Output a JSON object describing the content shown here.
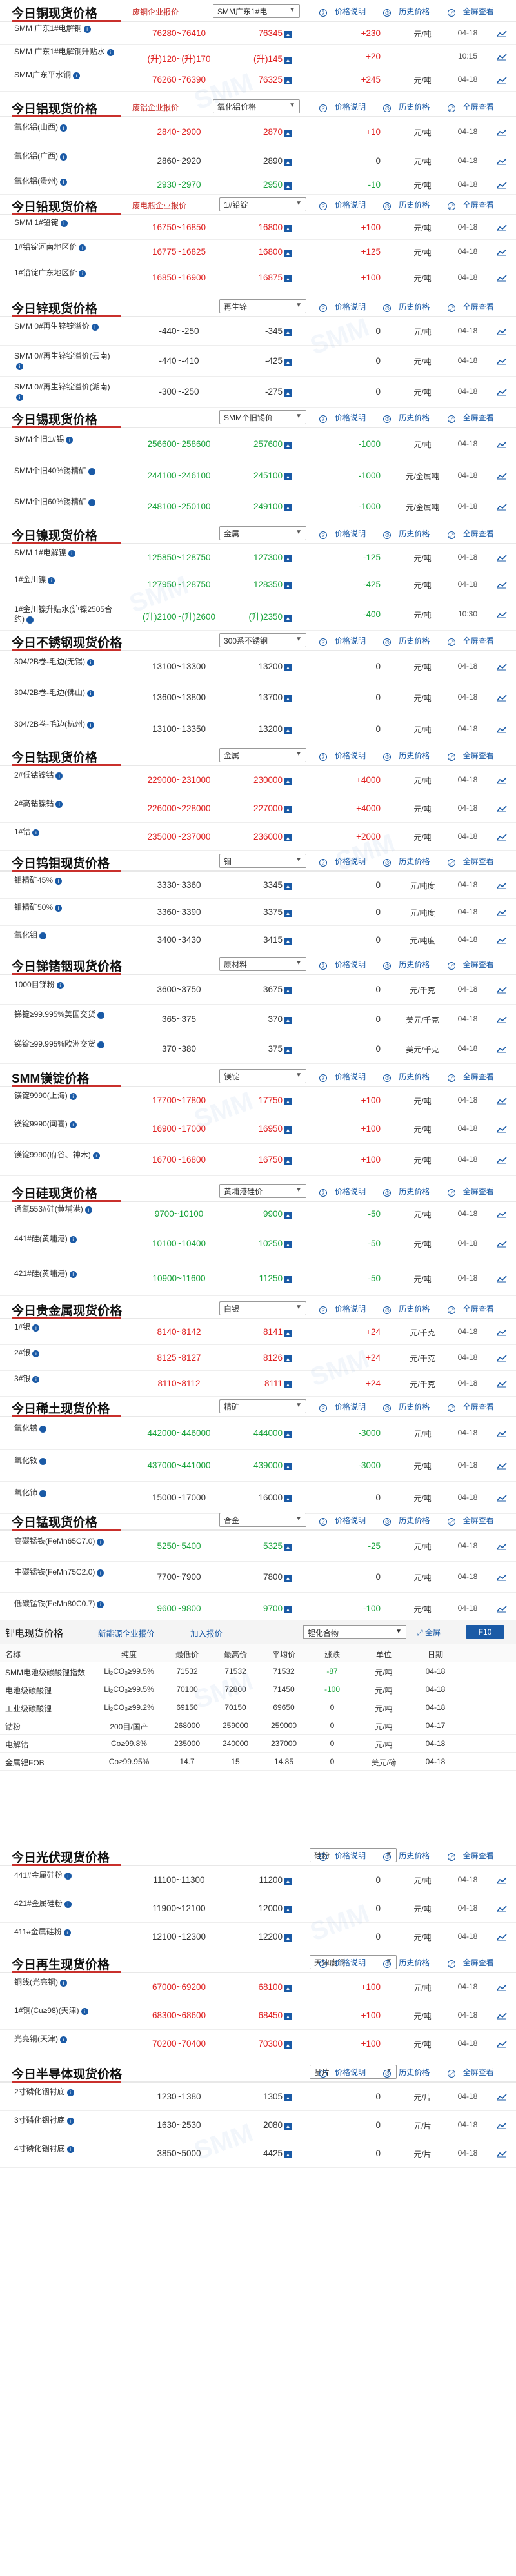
{
  "common": {
    "help": "价格说明",
    "history": "历史价格",
    "full": "全屏查看",
    "chart_icon": "trend-chart-icon"
  },
  "sections": [
    {
      "id": "copper",
      "title": "今日铜现货价格",
      "link": "废铜企业报价",
      "select": "SMM广东1#电",
      "rows": [
        {
          "name": "SMM 广东1#电解铜",
          "range": "76280~76410",
          "avg": "76345",
          "chg": "+230",
          "unit": "元/吨",
          "date": "04-18",
          "dir": "up"
        },
        {
          "name": "SMM 广东1#电解铜升贴水",
          "range": "(升)120~(升)170",
          "avg": "(升)145",
          "chg": "+20",
          "unit": "",
          "date": "10:15",
          "dir": "up"
        },
        {
          "name": "SMM广东平水铜",
          "range": "76260~76390",
          "avg": "76325",
          "chg": "+245",
          "unit": "元/吨",
          "date": "04-18",
          "dir": "up"
        }
      ]
    },
    {
      "id": "alumina",
      "title": "今日铝现货价格",
      "link": "废铝企业报价",
      "select": "氧化铝价格",
      "rows": [
        {
          "name": "氧化铝(山西)",
          "range": "2840~2900",
          "avg": "2870",
          "chg": "+10",
          "unit": "元/吨",
          "date": "04-18",
          "dir": "up"
        },
        {
          "name": "氧化铝(广西)",
          "range": "2860~2920",
          "avg": "2890",
          "chg": "0",
          "unit": "元/吨",
          "date": "04-18",
          "dir": "flat"
        },
        {
          "name": "氧化铝(贵州)",
          "range": "2930~2970",
          "avg": "2950",
          "chg": "-10",
          "unit": "元/吨",
          "date": "04-18",
          "dir": "down"
        }
      ]
    },
    {
      "id": "lead",
      "title": "今日铅现货价格",
      "link": "废电瓶企业报价",
      "select": "1#铅锭",
      "rows": [
        {
          "name": "SMM 1#铅锭",
          "range": "16750~16850",
          "avg": "16800",
          "chg": "+100",
          "unit": "元/吨",
          "date": "04-18",
          "dir": "up"
        },
        {
          "name": "1#铅锭河南地区价",
          "range": "16775~16825",
          "avg": "16800",
          "chg": "+125",
          "unit": "元/吨",
          "date": "04-18",
          "dir": "up"
        },
        {
          "name": "1#铅锭广东地区价",
          "range": "16850~16900",
          "avg": "16875",
          "chg": "+100",
          "unit": "元/吨",
          "date": "04-18",
          "dir": "up"
        }
      ]
    },
    {
      "id": "zinc",
      "title": "今日锌现货价格",
      "link": "",
      "select": "再生锌",
      "rows": [
        {
          "name": "SMM 0#再生锌锭溢价",
          "range": "-440~-250",
          "avg": "-345",
          "chg": "0",
          "unit": "元/吨",
          "date": "04-18",
          "dir": "flat"
        },
        {
          "name": "SMM 0#再生锌锭溢价(云南)",
          "range": "-440~-410",
          "avg": "-425",
          "chg": "0",
          "unit": "元/吨",
          "date": "04-18",
          "dir": "flat"
        },
        {
          "name": "SMM 0#再生锌锭溢价(湖南)",
          "range": "-300~-250",
          "avg": "-275",
          "chg": "0",
          "unit": "元/吨",
          "date": "04-18",
          "dir": "flat"
        }
      ]
    },
    {
      "id": "tin",
      "title": "今日锡现货价格",
      "link": "",
      "select": "SMM个旧锡价",
      "rows": [
        {
          "name": "SMM个旧1#锡",
          "range": "256600~258600",
          "avg": "257600",
          "chg": "-1000",
          "unit": "元/吨",
          "date": "04-18",
          "dir": "down"
        },
        {
          "name": "SMM个旧40%锡精矿",
          "range": "244100~246100",
          "avg": "245100",
          "chg": "-1000",
          "unit": "元/金属吨",
          "date": "04-18",
          "dir": "down"
        },
        {
          "name": "SMM个旧60%锡精矿",
          "range": "248100~250100",
          "avg": "249100",
          "chg": "-1000",
          "unit": "元/金属吨",
          "date": "04-18",
          "dir": "down"
        }
      ]
    },
    {
      "id": "nickel",
      "title": "今日镍现货价格",
      "link": "",
      "select": "金属",
      "rows": [
        {
          "name": "SMM 1#电解镍",
          "range": "125850~128750",
          "avg": "127300",
          "chg": "-125",
          "unit": "元/吨",
          "date": "04-18",
          "dir": "down"
        },
        {
          "name": "1#金川镍",
          "range": "127950~128750",
          "avg": "128350",
          "chg": "-425",
          "unit": "元/吨",
          "date": "04-18",
          "dir": "down"
        },
        {
          "name": "1#金川镍升贴水(沪镍2505合约)",
          "range": "(升)2100~(升)2600",
          "avg": "(升)2350",
          "chg": "-400",
          "unit": "元/吨",
          "date": "10:30",
          "dir": "down"
        }
      ]
    },
    {
      "id": "steel",
      "title": "今日不锈钢现货价格",
      "link": "",
      "select": "300系不锈钢",
      "rows": [
        {
          "name": "304/2B卷-毛边(无锡)",
          "range": "13100~13300",
          "avg": "13200",
          "chg": "0",
          "unit": "元/吨",
          "date": "04-18",
          "dir": "flat"
        },
        {
          "name": "304/2B卷-毛边(佛山)",
          "range": "13600~13800",
          "avg": "13700",
          "chg": "0",
          "unit": "元/吨",
          "date": "04-18",
          "dir": "flat"
        },
        {
          "name": "304/2B卷-毛边(杭州)",
          "range": "13100~13350",
          "avg": "13200",
          "chg": "0",
          "unit": "元/吨",
          "date": "04-18",
          "dir": "flat"
        }
      ]
    },
    {
      "id": "cobalt",
      "title": "今日钴现货价格",
      "link": "",
      "select": "金属",
      "rows": [
        {
          "name": "2#低钴镍钴",
          "range": "229000~231000",
          "avg": "230000",
          "chg": "+4000",
          "unit": "元/吨",
          "date": "04-18",
          "dir": "up"
        },
        {
          "name": "2#高钴镍钴",
          "range": "226000~228000",
          "avg": "227000",
          "chg": "+4000",
          "unit": "元/吨",
          "date": "04-18",
          "dir": "up"
        },
        {
          "name": "1#钴",
          "range": "235000~237000",
          "avg": "236000",
          "chg": "+2000",
          "unit": "元/吨",
          "date": "04-18",
          "dir": "up"
        }
      ]
    },
    {
      "id": "wm",
      "title": "今日钨钼现货价格",
      "link": "",
      "select": "钼",
      "rows": [
        {
          "name": "钼精矿45%",
          "range": "3330~3360",
          "avg": "3345",
          "chg": "0",
          "unit": "元/吨度",
          "date": "04-18",
          "dir": "flat"
        },
        {
          "name": "钼精矿50%",
          "range": "3360~3390",
          "avg": "3375",
          "chg": "0",
          "unit": "元/吨度",
          "date": "04-18",
          "dir": "flat"
        },
        {
          "name": "氧化钼",
          "range": "3400~3430",
          "avg": "3415",
          "chg": "0",
          "unit": "元/吨度",
          "date": "04-18",
          "dir": "flat"
        }
      ]
    },
    {
      "id": "sbge",
      "title": "今日锑锗铟现货价格",
      "link": "",
      "select": "原材料",
      "rows": [
        {
          "name": "1000目锑粉",
          "range": "3600~3750",
          "avg": "3675",
          "chg": "0",
          "unit": "元/千克",
          "date": "04-18",
          "dir": "flat"
        },
        {
          "name": "锑锭≥99.995%美国交货",
          "range": "365~375",
          "avg": "370",
          "chg": "0",
          "unit": "美元/千克",
          "date": "04-18",
          "dir": "flat"
        },
        {
          "name": "锑锭≥99.995%欧洲交货",
          "range": "370~380",
          "avg": "375",
          "chg": "0",
          "unit": "美元/千克",
          "date": "04-18",
          "dir": "flat"
        }
      ]
    },
    {
      "id": "mg",
      "title": "SMM镁锭价格",
      "link": "",
      "select": "镁锭",
      "rows": [
        {
          "name": "镁锭9990(上海)",
          "range": "17700~17800",
          "avg": "17750",
          "chg": "+100",
          "unit": "元/吨",
          "date": "04-18",
          "dir": "up"
        },
        {
          "name": "镁锭9990(闻喜)",
          "range": "16900~17000",
          "avg": "16950",
          "chg": "+100",
          "unit": "元/吨",
          "date": "04-18",
          "dir": "up"
        },
        {
          "name": "镁锭9990(府谷、神木)",
          "range": "16700~16800",
          "avg": "16750",
          "chg": "+100",
          "unit": "元/吨",
          "date": "04-18",
          "dir": "up"
        }
      ]
    },
    {
      "id": "si",
      "title": "今日硅现货价格",
      "link": "",
      "select": "黄埔港硅价",
      "rows": [
        {
          "name": "通氧553#硅(黄埔港)",
          "range": "9700~10100",
          "avg": "9900",
          "chg": "-50",
          "unit": "元/吨",
          "date": "04-18",
          "dir": "down"
        },
        {
          "name": "441#硅(黄埔港)",
          "range": "10100~10400",
          "avg": "10250",
          "chg": "-50",
          "unit": "元/吨",
          "date": "04-18",
          "dir": "down"
        },
        {
          "name": "421#硅(黄埔港)",
          "range": "10900~11600",
          "avg": "11250",
          "chg": "-50",
          "unit": "元/吨",
          "date": "04-18",
          "dir": "down"
        }
      ]
    },
    {
      "id": "precious",
      "title": "今日贵金属现货价格",
      "link": "",
      "select": "白银",
      "rows": [
        {
          "name": "1#银",
          "range": "8140~8142",
          "avg": "8141",
          "chg": "+24",
          "unit": "元/千克",
          "date": "04-18",
          "dir": "up"
        },
        {
          "name": "2#银",
          "range": "8125~8127",
          "avg": "8126",
          "chg": "+24",
          "unit": "元/千克",
          "date": "04-18",
          "dir": "up"
        },
        {
          "name": "3#银",
          "range": "8110~8112",
          "avg": "8111",
          "chg": "+24",
          "unit": "元/千克",
          "date": "04-18",
          "dir": "up"
        }
      ]
    },
    {
      "id": "re",
      "title": "今日稀土现货价格",
      "link": "",
      "select": "精矿",
      "rows": [
        {
          "name": "氧化镨",
          "range": "442000~446000",
          "avg": "444000",
          "chg": "-3000",
          "unit": "元/吨",
          "date": "04-18",
          "dir": "down"
        },
        {
          "name": "氧化钕",
          "range": "437000~441000",
          "avg": "439000",
          "chg": "-3000",
          "unit": "元/吨",
          "date": "04-18",
          "dir": "down"
        },
        {
          "name": "氧化铈",
          "range": "15000~17000",
          "avg": "16000",
          "chg": "0",
          "unit": "元/吨",
          "date": "04-18",
          "dir": "flat"
        }
      ]
    },
    {
      "id": "mn",
      "title": "今日锰现货价格",
      "link": "",
      "select": "合金",
      "rows": [
        {
          "name": "高碳锰铁(FeMn65C7.0)",
          "range": "5250~5400",
          "avg": "5325",
          "chg": "-25",
          "unit": "元/吨",
          "date": "04-18",
          "dir": "down"
        },
        {
          "name": "中碳锰铁(FeMn75C2.0)",
          "range": "7700~7900",
          "avg": "7800",
          "chg": "0",
          "unit": "元/吨",
          "date": "04-18",
          "dir": "flat"
        },
        {
          "name": "低碳锰铁(FeMn80C0.7)",
          "range": "9600~9800",
          "avg": "9700",
          "chg": "-100",
          "unit": "元/吨",
          "date": "04-18",
          "dir": "down"
        }
      ]
    }
  ],
  "lithium": {
    "title": "锂电现货价格",
    "link1": "新能源企业报价",
    "link2": "加入报价",
    "select": "锂化合物",
    "btn1": "全屏",
    "btn2": "F10",
    "headers": [
      "名称",
      "纯度",
      "最低价",
      "最高价",
      "平均价",
      "涨跌",
      "单位",
      "日期"
    ],
    "rows": [
      {
        "name": "SMM电池级碳酸锂指数",
        "purity": "Li₂CO₃≥99.5%",
        "low": "71532",
        "high": "71532",
        "avg": "71532",
        "chg": "-87",
        "unit": "元/吨",
        "date": "04-18",
        "dir": "down"
      },
      {
        "name": "电池级碳酸锂",
        "purity": "Li₂CO₃≥99.5%",
        "low": "70100",
        "high": "72800",
        "avg": "71450",
        "chg": "-100",
        "unit": "元/吨",
        "date": "04-18",
        "dir": "down"
      },
      {
        "name": "工业级碳酸锂",
        "purity": "Li₂CO₃≥99.2%",
        "low": "69150",
        "high": "70150",
        "avg": "69650",
        "chg": "0",
        "unit": "元/吨",
        "date": "04-18",
        "dir": "flat"
      },
      {
        "name": "钴粉",
        "purity": "200目/国产",
        "low": "268000",
        "high": "259000",
        "avg": "259000",
        "chg": "0",
        "unit": "元/吨",
        "date": "04-17",
        "dir": "flat"
      },
      {
        "name": "电解钴",
        "purity": "Co≥99.8%",
        "low": "235000",
        "high": "240000",
        "avg": "237000",
        "chg": "0",
        "unit": "元/吨",
        "date": "04-18",
        "dir": "flat"
      },
      {
        "name": "金属锂FOB",
        "purity": "Co≥99.95%",
        "low": "14.7",
        "high": "15",
        "avg": "14.85",
        "chg": "0",
        "unit": "美元/磅",
        "date": "04-18",
        "dir": "flat"
      }
    ]
  },
  "sections2": [
    {
      "id": "pv",
      "title": "今日光伏现货价格",
      "link": "",
      "select": "硅粉",
      "rows": [
        {
          "name": "441#金属硅粉",
          "range": "11100~11300",
          "avg": "11200",
          "chg": "0",
          "unit": "元/吨",
          "date": "04-18",
          "dir": "flat"
        },
        {
          "name": "421#金属硅粉",
          "range": "11900~12100",
          "avg": "12000",
          "chg": "0",
          "unit": "元/吨",
          "date": "04-18",
          "dir": "flat"
        },
        {
          "name": "411#金属硅粉",
          "range": "12100~12300",
          "avg": "12200",
          "chg": "0",
          "unit": "元/吨",
          "date": "04-18",
          "dir": "flat"
        }
      ]
    },
    {
      "id": "recycle",
      "title": "今日再生现货价格",
      "link": "",
      "select": "天津废铜",
      "rows": [
        {
          "name": "铜线(光亮铜)",
          "range": "67000~69200",
          "avg": "68100",
          "chg": "+100",
          "unit": "元/吨",
          "date": "04-18",
          "dir": "up"
        },
        {
          "name": "1#铜(Cu≥98)(天津)",
          "range": "68300~68600",
          "avg": "68450",
          "chg": "+100",
          "unit": "元/吨",
          "date": "04-18",
          "dir": "up"
        },
        {
          "name": "光亮铜(天津)",
          "range": "70200~70400",
          "avg": "70300",
          "chg": "+100",
          "unit": "元/吨",
          "date": "04-18",
          "dir": "up"
        }
      ]
    },
    {
      "id": "semi",
      "title": "今日半导体现货价格",
      "link": "",
      "select": "晶片",
      "rows": [
        {
          "name": "2寸磷化铟衬底",
          "range": "1230~1380",
          "avg": "1305",
          "chg": "0",
          "unit": "元/片",
          "date": "04-18",
          "dir": "flat"
        },
        {
          "name": "3寸磷化铟衬底",
          "range": "1630~2530",
          "avg": "2080",
          "chg": "0",
          "unit": "元/片",
          "date": "04-18",
          "dir": "flat"
        },
        {
          "name": "4寸磷化铟衬底",
          "range": "3850~5000",
          "avg": "4425",
          "chg": "0",
          "unit": "元/片",
          "date": "04-18",
          "dir": "flat"
        }
      ]
    }
  ],
  "colors": {
    "up": "#e02020",
    "down": "#19a33b",
    "accent": "#1a5aa6",
    "brand_red": "#c9302c"
  }
}
